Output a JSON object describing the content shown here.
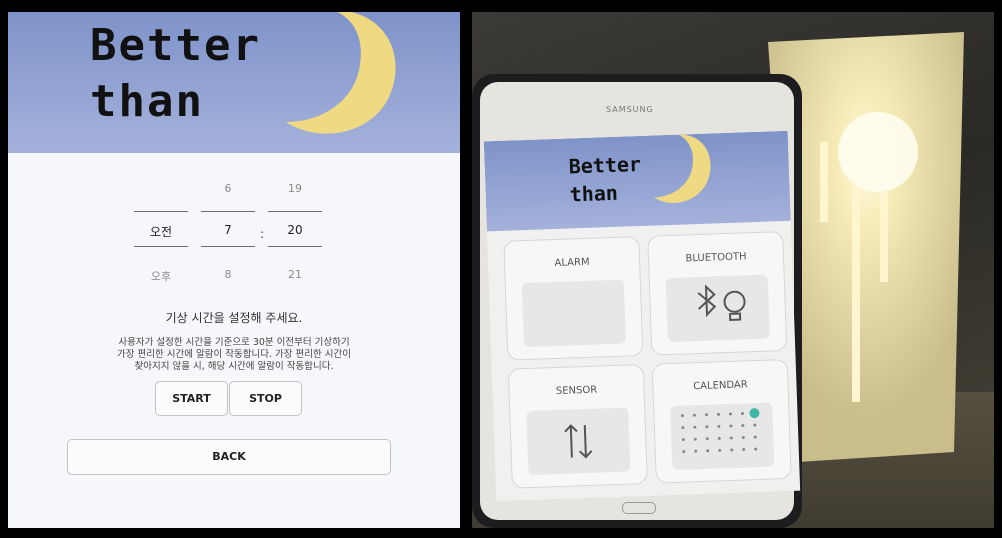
{
  "app": {
    "title_line1": "Better",
    "title_line2": "than"
  },
  "time_picker": {
    "ampm": {
      "prev": "",
      "selected": "오전",
      "next": "오후"
    },
    "hour": {
      "prev": "6",
      "selected": "7",
      "next": "8"
    },
    "separator": ":",
    "minute": {
      "prev": "19",
      "selected": "20",
      "next": "21"
    }
  },
  "alarm": {
    "prompt": "기상 시간을  설정해 주세요.",
    "description": [
      "사용자가 설정한 시간을 기준으로 30분 이전부터 기상하기",
      "가장 편리한 시간에 알람이 작동합니다. 가장 편리한 시간이",
      "찾아지지 않을 시, 해당 시간에 알람이 작동합니다."
    ]
  },
  "buttons": {
    "start": "START",
    "stop": "STOP",
    "back": "BACK"
  },
  "photo": {
    "tablet_brand": "SAMSUNG",
    "screen_title_line1": "Better",
    "screen_title_line2": "than",
    "tiles": [
      {
        "label": "ALARM"
      },
      {
        "label": "BLUETOOTH"
      },
      {
        "label": "SENSOR"
      },
      {
        "label": "CALENDAR"
      }
    ]
  },
  "colors": {
    "banner_top": "#7f93c9",
    "banner_bottom": "#a4b1db",
    "moon": "#f0d983",
    "page_bg": "#f6f7fa",
    "calendar_highlight": "#3fb5a3"
  }
}
